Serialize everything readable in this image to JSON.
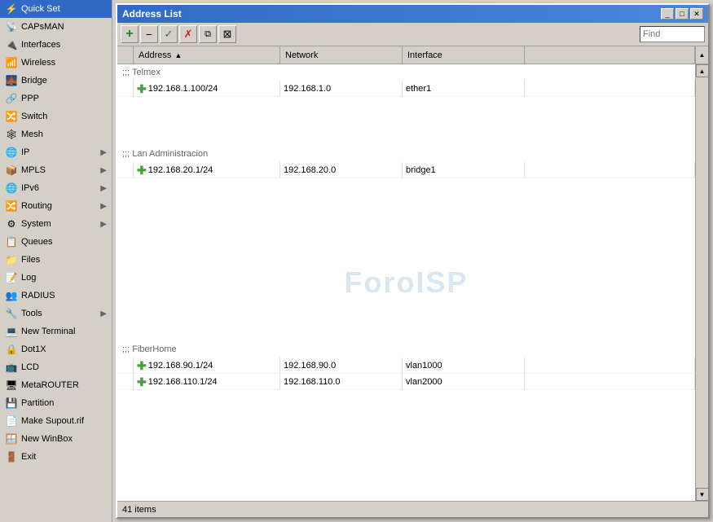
{
  "sidebar": {
    "items": [
      {
        "id": "quick-set",
        "label": "Quick Set",
        "icon": "⚡",
        "hasArrow": false
      },
      {
        "id": "capsman",
        "label": "CAPsMAN",
        "icon": "📡",
        "hasArrow": false
      },
      {
        "id": "interfaces",
        "label": "Interfaces",
        "icon": "🔌",
        "hasArrow": false
      },
      {
        "id": "wireless",
        "label": "Wireless",
        "icon": "📶",
        "hasArrow": false
      },
      {
        "id": "bridge",
        "label": "Bridge",
        "icon": "🌉",
        "hasArrow": false
      },
      {
        "id": "ppp",
        "label": "PPP",
        "icon": "🔗",
        "hasArrow": false
      },
      {
        "id": "switch",
        "label": "Switch",
        "icon": "🔀",
        "hasArrow": false
      },
      {
        "id": "mesh",
        "label": "Mesh",
        "icon": "🕸️",
        "hasArrow": false
      },
      {
        "id": "ip",
        "label": "IP",
        "icon": "🌐",
        "hasArrow": true
      },
      {
        "id": "mpls",
        "label": "MPLS",
        "icon": "📦",
        "hasArrow": true
      },
      {
        "id": "ipv6",
        "label": "IPv6",
        "icon": "🌐",
        "hasArrow": true
      },
      {
        "id": "routing",
        "label": "Routing",
        "icon": "🔀",
        "hasArrow": true
      },
      {
        "id": "system",
        "label": "System",
        "icon": "⚙️",
        "hasArrow": true
      },
      {
        "id": "queues",
        "label": "Queues",
        "icon": "📋",
        "hasArrow": false
      },
      {
        "id": "files",
        "label": "Files",
        "icon": "📁",
        "hasArrow": false
      },
      {
        "id": "log",
        "label": "Log",
        "icon": "📝",
        "hasArrow": false
      },
      {
        "id": "radius",
        "label": "RADIUS",
        "icon": "👥",
        "hasArrow": false
      },
      {
        "id": "tools",
        "label": "Tools",
        "icon": "🔧",
        "hasArrow": true
      },
      {
        "id": "new-terminal",
        "label": "New Terminal",
        "icon": "💻",
        "hasArrow": false
      },
      {
        "id": "dot1x",
        "label": "Dot1X",
        "icon": "🔒",
        "hasArrow": false
      },
      {
        "id": "lcd",
        "label": "LCD",
        "icon": "📺",
        "hasArrow": false
      },
      {
        "id": "metarouter",
        "label": "MetaROUTER",
        "icon": "🖥️",
        "hasArrow": false
      },
      {
        "id": "partition",
        "label": "Partition",
        "icon": "💾",
        "hasArrow": false
      },
      {
        "id": "make-supout",
        "label": "Make Supout.rif",
        "icon": "📄",
        "hasArrow": false
      },
      {
        "id": "new-winbox",
        "label": "New WinBox",
        "icon": "🪟",
        "hasArrow": false
      },
      {
        "id": "exit",
        "label": "Exit",
        "icon": "🚪",
        "hasArrow": false
      }
    ]
  },
  "window": {
    "title": "Address List",
    "toolbar": {
      "add_label": "+",
      "remove_label": "−",
      "check_label": "✓",
      "cross_label": "✗",
      "copy_label": "⧉",
      "filter_label": "⊠",
      "find_placeholder": "Find"
    },
    "columns": [
      {
        "id": "address",
        "label": "Address",
        "sort": "asc"
      },
      {
        "id": "network",
        "label": "Network",
        "sort": "none"
      },
      {
        "id": "interface",
        "label": "Interface",
        "sort": "none"
      }
    ],
    "sections": [
      {
        "comment": ";;; Telmex",
        "rows": [
          {
            "address": "192.168.1.100/24",
            "network": "192.168.1.0",
            "interface": "ether1"
          }
        ]
      },
      {
        "comment": ";;; Lan Administracion",
        "rows": [
          {
            "address": "192.168.20.1/24",
            "network": "192.168.20.0",
            "interface": "bridge1"
          }
        ]
      },
      {
        "comment": ";;; FiberHome",
        "rows": [
          {
            "address": "192.168.90.1/24",
            "network": "192.168.90.0",
            "interface": "vlan1000"
          },
          {
            "address": "192.168.110.1/24",
            "network": "192.168.110.0",
            "interface": "vlan2000"
          }
        ]
      }
    ],
    "watermark": "ForoISP",
    "status": "41 items"
  }
}
